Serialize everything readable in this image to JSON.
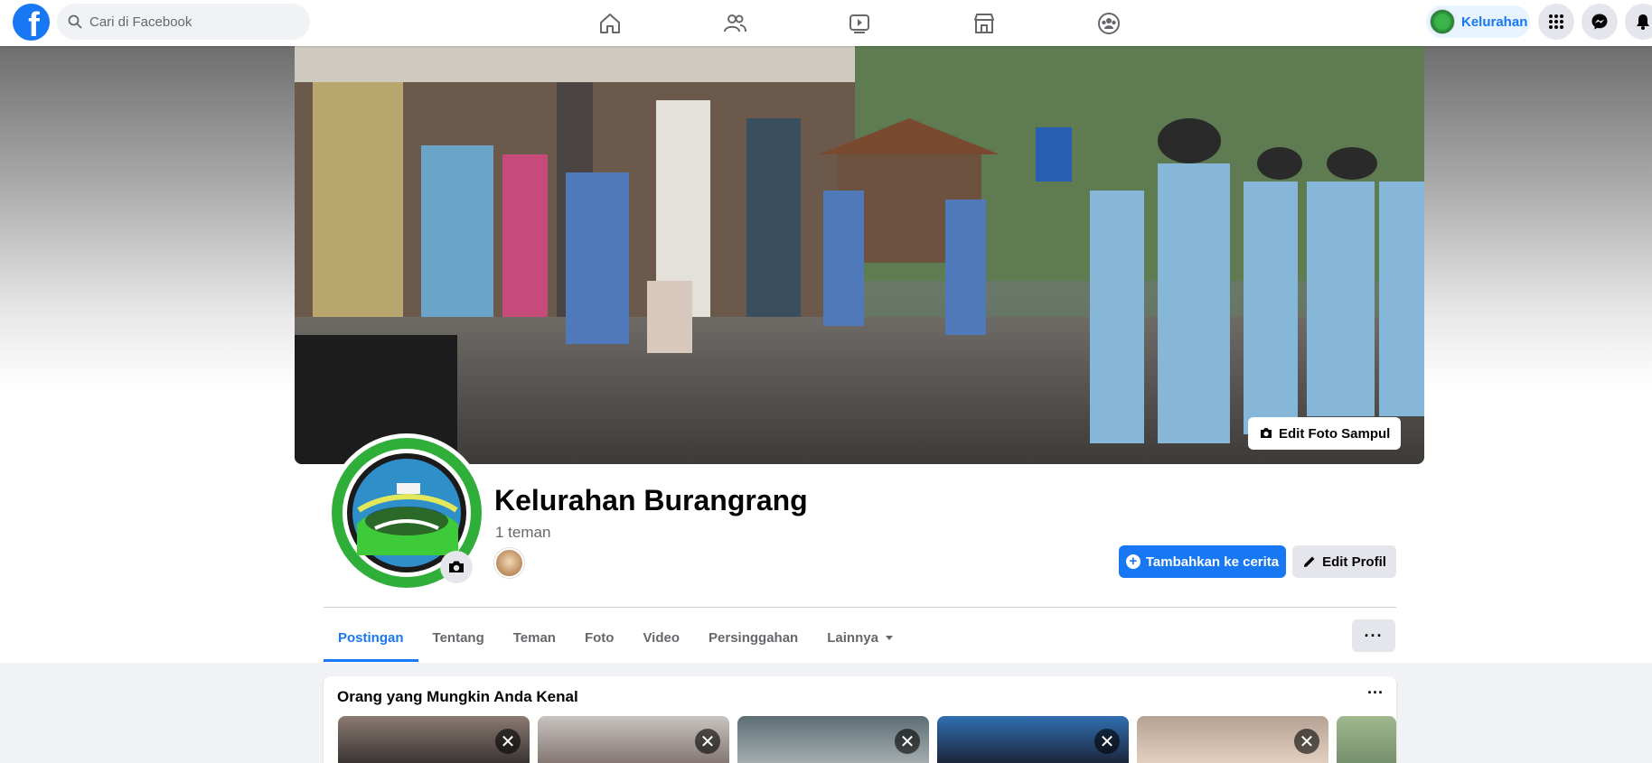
{
  "topbar": {
    "logo": "facebook-logo",
    "logo_letter": "f",
    "search_placeholder": "Cari di Facebook",
    "nav_icons": [
      "home-icon",
      "friends-icon",
      "watch-icon",
      "marketplace-icon",
      "groups-icon"
    ],
    "profile_pill_label": "Kelurahan",
    "right_icons": [
      "menu-grid-icon",
      "messenger-icon",
      "notifications-icon"
    ]
  },
  "cover": {
    "edit_label": "Edit Foto Sampul"
  },
  "profile": {
    "name": "Kelurahan Burangrang",
    "friends_count": "1 teman",
    "add_story_label": "Tambahkan ke cerita",
    "edit_profile_label": "Edit Profil"
  },
  "tabs": [
    {
      "label": "Postingan",
      "active": true
    },
    {
      "label": "Tentang",
      "active": false
    },
    {
      "label": "Teman",
      "active": false
    },
    {
      "label": "Foto",
      "active": false
    },
    {
      "label": "Video",
      "active": false
    },
    {
      "label": "Persinggahan",
      "active": false
    },
    {
      "label": "Lainnya",
      "active": false
    }
  ],
  "more_button_label": "···",
  "pymk": {
    "title": "Orang yang Mungkin Anda Kenal",
    "menu_label": "···",
    "dismiss_label": "✕"
  },
  "colors": {
    "brand": "#1877f2",
    "background": "#f0f2f5",
    "secondary_text": "#65676b"
  }
}
